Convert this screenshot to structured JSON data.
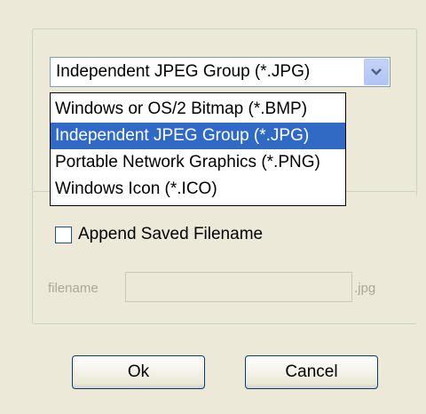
{
  "format_combo": {
    "selected_value": "Independent JPEG Group (*.JPG)",
    "options": [
      "Windows or OS/2 Bitmap (*.BMP)",
      "Independent JPEG Group (*.JPG)",
      "Portable Network Graphics (*.PNG)",
      "Windows Icon (*.ICO)"
    ],
    "highlighted_index": 1,
    "arrow_icon": "chevron-down-icon"
  },
  "append_filename": {
    "label": "Append Saved Filename",
    "checked": false
  },
  "filename": {
    "label": "filename",
    "value": "",
    "extension": ".jpg",
    "enabled": false
  },
  "buttons": {
    "ok_label": "Ok",
    "cancel_label": "Cancel"
  },
  "colors": {
    "dialog_background": "#ece9d8",
    "selection_highlight": "#316ac5",
    "disabled_text": "#aca899"
  }
}
